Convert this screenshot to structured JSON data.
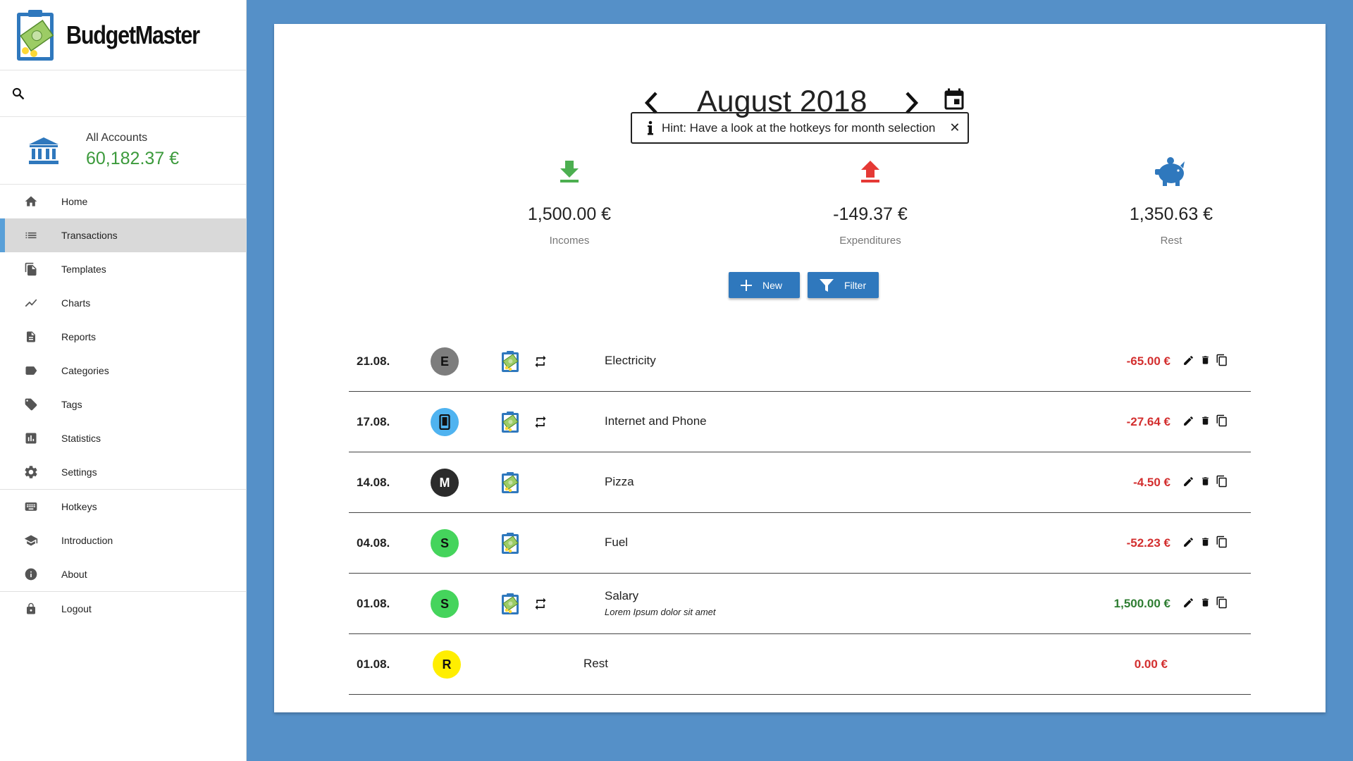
{
  "app": {
    "name": "BudgetMaster"
  },
  "sidebar": {
    "account": {
      "label": "All Accounts",
      "value": "60,182.37 €"
    },
    "items": [
      {
        "label": "Home",
        "icon": "home-icon"
      },
      {
        "label": "Transactions",
        "icon": "list-icon",
        "active": true
      },
      {
        "label": "Templates",
        "icon": "file-copy-icon"
      },
      {
        "label": "Charts",
        "icon": "line-chart-icon"
      },
      {
        "label": "Reports",
        "icon": "document-icon"
      },
      {
        "label": "Categories",
        "icon": "label-icon"
      },
      {
        "label": "Tags",
        "icon": "tag-icon"
      },
      {
        "label": "Statistics",
        "icon": "bar-chart-icon"
      },
      {
        "label": "Settings",
        "icon": "gear-icon"
      },
      {
        "label": "Hotkeys",
        "icon": "keyboard-icon"
      },
      {
        "label": "Introduction",
        "icon": "graduation-cap-icon"
      },
      {
        "label": "About",
        "icon": "info-icon"
      },
      {
        "label": "Logout",
        "icon": "lock-icon"
      }
    ]
  },
  "main": {
    "month": "August 2018",
    "hint": "Hint: Have a look at the hotkeys for month selection",
    "summary": {
      "incomes": {
        "value": "1,500.00 €",
        "label": "Incomes",
        "color": "#4caf50"
      },
      "expenditures": {
        "value": "-149.37 €",
        "label": "Expenditures",
        "color": "#e53935"
      },
      "rest": {
        "value": "1,350.63 €",
        "label": "Rest",
        "color": "#2f78bd"
      }
    },
    "buttons": {
      "new": "New",
      "filter": "Filter"
    },
    "transactions": [
      {
        "date": "21.08.",
        "badge": "E",
        "badge_color": "#7d7d7d",
        "badge_text_color": "#111",
        "repeat": true,
        "name": "Electricity",
        "description": "",
        "amount": "-65.00 €",
        "amount_color": "#d32f2f"
      },
      {
        "date": "17.08.",
        "badge": "",
        "badge_icon": "phone-icon",
        "badge_color": "#4fb3f0",
        "badge_text_color": "#111",
        "repeat": true,
        "name": "Internet and Phone",
        "description": "",
        "amount": "-27.64 €",
        "amount_color": "#d32f2f"
      },
      {
        "date": "14.08.",
        "badge": "M",
        "badge_color": "#2b2b2b",
        "badge_text_color": "#fff",
        "repeat": false,
        "name": "Pizza",
        "description": "",
        "amount": "-4.50 €",
        "amount_color": "#d32f2f"
      },
      {
        "date": "04.08.",
        "badge": "S",
        "badge_color": "#45d45c",
        "badge_text_color": "#111",
        "repeat": false,
        "name": "Fuel",
        "description": "",
        "amount": "-52.23 €",
        "amount_color": "#d32f2f"
      },
      {
        "date": "01.08.",
        "badge": "S",
        "badge_color": "#45d45c",
        "badge_text_color": "#111",
        "repeat": true,
        "name": "Salary",
        "description": "Lorem Ipsum dolor sit amet",
        "amount": "1,500.00 €",
        "amount_color": "#2e7d32"
      },
      {
        "date": "01.08.",
        "badge": "R",
        "badge_color": "#ffee00",
        "badge_text_color": "#111",
        "repeat": false,
        "name": "Rest",
        "description": "",
        "amount": "0.00 €",
        "amount_color": "#d32f2f"
      }
    ]
  }
}
